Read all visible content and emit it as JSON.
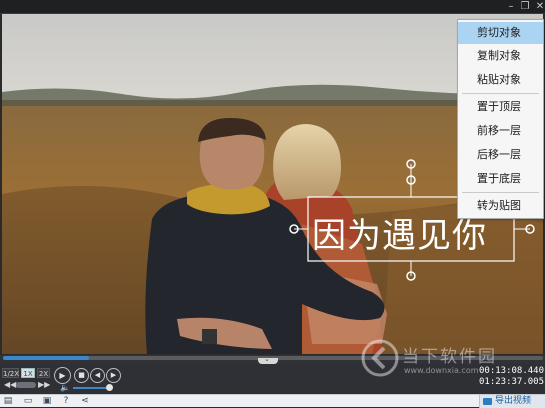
{
  "window": {
    "minimize_icon": "minimize-icon",
    "maximize_icon": "maximize-icon",
    "close_icon": "close-icon"
  },
  "canvas": {
    "overlay_text": "因为遇见你"
  },
  "context_menu": {
    "items": [
      {
        "label": "剪切对象",
        "active": true
      },
      {
        "label": "复制对象"
      },
      {
        "label": "粘贴对象"
      },
      {
        "label": "置于顶层"
      },
      {
        "label": "前移一层"
      },
      {
        "label": "后移一层"
      },
      {
        "label": "置于底层"
      },
      {
        "label": "转为贴图"
      }
    ]
  },
  "playback": {
    "speeds": [
      "1/2X",
      "1X",
      "2X"
    ],
    "selected_speed": "1X",
    "progress": 0.16,
    "volume": 0.85,
    "current_time": "00:13:08.440",
    "total_time": "01:23:37.005"
  },
  "toolbar": {
    "export_label": "导出视频"
  },
  "watermark": {
    "text": "当下软件园",
    "sub": "www.downxia.com"
  },
  "colors": {
    "accent": "#3f86c9",
    "menu_highlight": "#abd4f2"
  }
}
